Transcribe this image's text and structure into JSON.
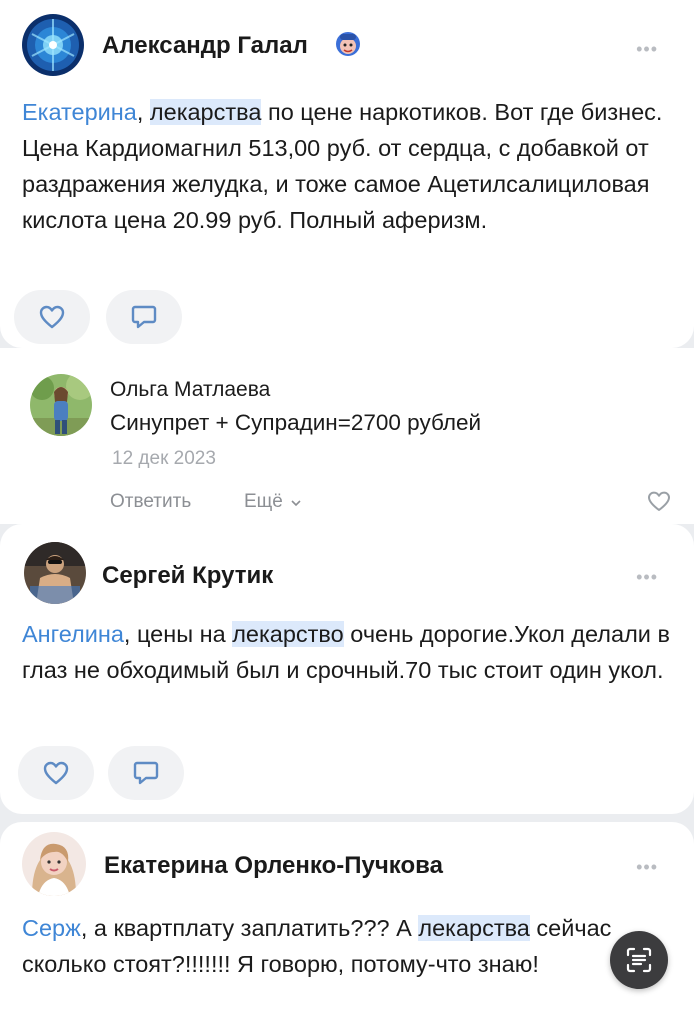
{
  "posts": [
    {
      "author": "Александр Галал",
      "badge_icon": "sticker-emoji-icon",
      "more_label": "•••",
      "mention": "Екатерина",
      "comma": ", ",
      "keyword": "лекарства",
      "text_rest": " по цене наркотиков. Вот где бизнес. Цена Кардиомагнил 513,00 руб. от сердца, с добавкой от раздражения желудка, и тоже самое Ацетилсалициловая кислота цена 20.99 руб. Полный аферизм.",
      "actions": [
        "heart-icon",
        "comment-icon"
      ]
    },
    {
      "author": "Сергей Крутик",
      "more_label": "•••",
      "mention": "Ангелина",
      "text_mid": ", цены на ",
      "keyword": "лекарство",
      "text_rest": " очень дорогие.Укол делали в глаз не обходимый был и срочный.70 тыс стоит один укол.",
      "actions": [
        "heart-icon",
        "comment-icon"
      ]
    },
    {
      "author": "Екатерина Орленко-Пучкова",
      "more_label": "•••",
      "mention": "Серж",
      "text_mid": ", а квартплату заплатить??? А ",
      "keyword": "лекарства",
      "text_rest": " сейчас сколько стоят?!!!!!!! Я говорю, потому-что знаю!"
    }
  ],
  "reply": {
    "author": "Ольга Матлаева",
    "text": "Синупрет + Супрадин=2700 рублей",
    "date": "12 дек 2023",
    "reply_label": "Ответить",
    "more_label": "Ещё",
    "more_icon": "chevron-down-icon"
  },
  "colors": {
    "mention": "#3f86d6",
    "highlight": "#dce9fb",
    "background": "#ebedf0",
    "muted": "#a6a9ae"
  },
  "fab": {
    "icon": "text-scan-icon"
  }
}
